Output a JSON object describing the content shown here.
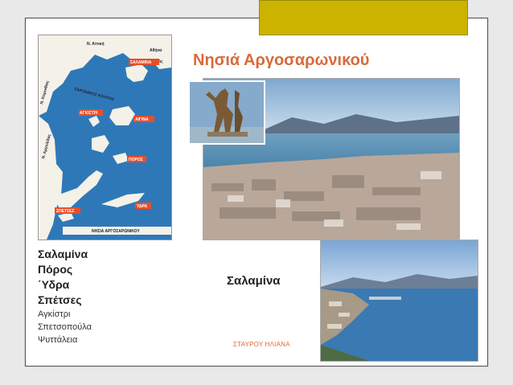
{
  "title": "Νησιά Αργοσαρωνικού",
  "islands_main": [
    "Σαλαμίνα",
    "Πόρος",
    "΄Υδρα",
    "Σπέτσες"
  ],
  "islands_small": [
    "Αγκίστρι",
    "Σπετσοπούλα",
    "Ψυττάλεια"
  ],
  "caption": "Σαλαμίνα",
  "author": "ΣΤΑΥΡΟΥ ΗΛΙΑΝΑ",
  "map": {
    "sea_label": "ΣΑΡΩΝΙΚΟΣ ΚΟΛΠΟΣ",
    "footer": "ΝΗΣΙΑ ΑΡΓΟΣΑΡΩΝΙΚΟΥ",
    "tags": [
      "ΣΑΛΑΜΙΝΑ",
      "ΑΙΓΙΝΑ",
      "ΑΓΚΙΣΤΡΙ",
      "ΠΟΡΟΣ",
      "ΥΔΡΑ",
      "ΣΠΕΤΣΕΣ"
    ],
    "places": [
      "Ν. Αττική",
      "Αθήνα",
      "Πειραιάς",
      "Ν. Κορινθίας",
      "Ν. Αργολίδας"
    ]
  },
  "colors": {
    "title": "#d86a3a",
    "gold": "#cbb300",
    "sea": "#2f78b8",
    "land": "#f3f1e8"
  }
}
